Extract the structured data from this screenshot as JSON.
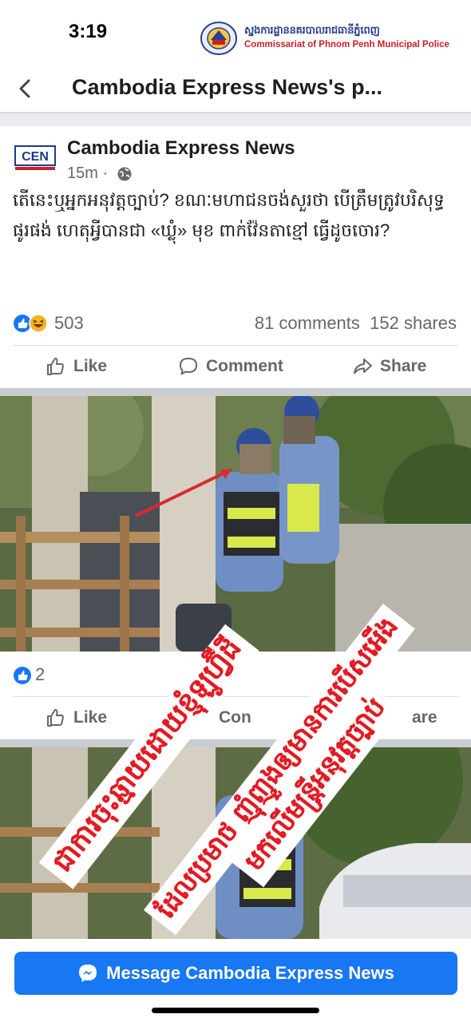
{
  "status": {
    "time": "3:19"
  },
  "watermark": {
    "khmer": "ស្នងការដ្ឋាននគរបាលរាជធានីភ្នំពេញ",
    "english": "Commissariat of Phnom Penh Municipal Police"
  },
  "nav": {
    "title": "Cambodia Express News's p...",
    "back_icon": "chevron-left-icon"
  },
  "post": {
    "page_name": "Cambodia Express News",
    "avatar_text": "CEN",
    "time": "15m · ",
    "text": "តើនេះឬអ្នកអនុវត្តច្បាប់? ខណៈមហាជនចង់សួរថា បើត្រឹមត្រូវបរិសុទ្ធផូរផង់ ហេតុអ្វីបានជា «ឃ្លុំ» មុខ ពាក់វ៉ែនតាខ្មៅ ធ្វើដូចចោរ?",
    "reaction_count": "503",
    "comments": "81 comments",
    "shares": "152 shares"
  },
  "actions": {
    "like": "Like",
    "comment": "Comment",
    "share": "Share"
  },
  "shared": {
    "reaction_count": "2",
    "like": "Like",
    "comment_partial": "Con",
    "share_partial": "are"
  },
  "overlay": {
    "lines": [
      "ជាការចុះឆ្មាយដោយខ្ញុំឡូហ្វ៊ីដី",
      "ដែលប្រមាថ ញុំញួងឲ្យមានការបើសអើង",
      "មកលើមន្ត្រីអនុវត្តច្បាប់"
    ]
  },
  "message_button": {
    "label": "Message Cambodia Express News",
    "icon": "messenger-icon"
  },
  "colors": {
    "brand": "#1877f2",
    "stamp": "#e31b23",
    "police_blue": "#6f8fc4",
    "vest_yellow": "#d9e84a"
  }
}
